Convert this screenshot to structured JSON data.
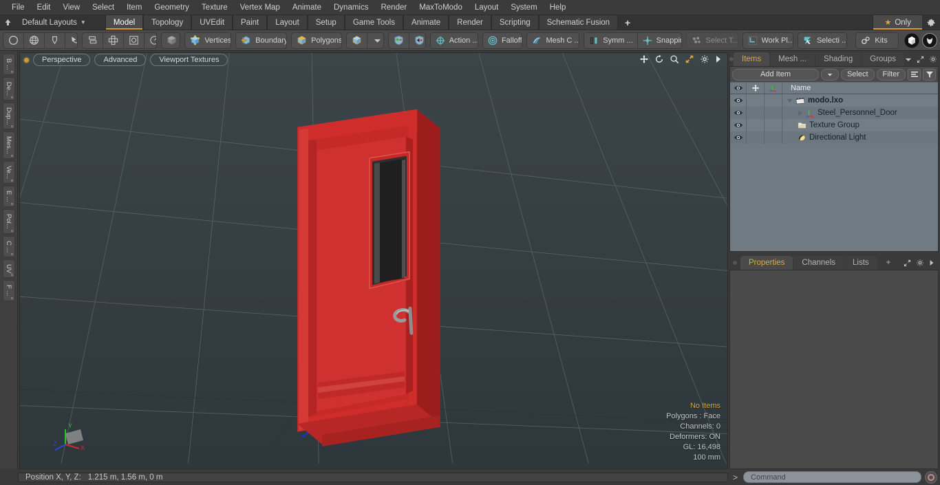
{
  "app": {
    "title": "modo"
  },
  "menubar": {
    "items": [
      {
        "label": "File"
      },
      {
        "label": "Edit"
      },
      {
        "label": "View"
      },
      {
        "label": "Select"
      },
      {
        "label": "Item"
      },
      {
        "label": "Geometry"
      },
      {
        "label": "Texture"
      },
      {
        "label": "Vertex Map"
      },
      {
        "label": "Animate"
      },
      {
        "label": "Dynamics"
      },
      {
        "label": "Render"
      },
      {
        "label": "MaxToModo"
      },
      {
        "label": "Layout"
      },
      {
        "label": "System"
      },
      {
        "label": "Help"
      }
    ]
  },
  "layoutbar": {
    "home_icon": "home-icon",
    "layout_name": "Default Layouts",
    "tabs": [
      {
        "label": "Model",
        "active": true
      },
      {
        "label": "Topology",
        "active": false
      },
      {
        "label": "UVEdit",
        "active": false
      },
      {
        "label": "Paint",
        "active": false
      },
      {
        "label": "Layout",
        "active": false
      },
      {
        "label": "Setup",
        "active": false
      },
      {
        "label": "Game Tools",
        "active": false
      },
      {
        "label": "Animate",
        "active": false
      },
      {
        "label": "Render",
        "active": false
      },
      {
        "label": "Scripting",
        "active": false
      },
      {
        "label": "Schematic Fusion",
        "active": false
      }
    ],
    "add_tab_label": "+",
    "only_label": "Only",
    "settings_icon": "gear-icon"
  },
  "toolbar": {
    "groups": [
      {
        "name": "primitives",
        "buttons": [
          {
            "label": "",
            "icon": "circle-icon"
          },
          {
            "label": "",
            "icon": "globe-icon"
          },
          {
            "label": "",
            "icon": "pen-icon"
          },
          {
            "label": "",
            "icon": "curve-icon"
          }
        ]
      },
      {
        "name": "align",
        "buttons": [
          {
            "label": "",
            "icon": "align-icon"
          },
          {
            "label": "",
            "icon": "center-icon"
          },
          {
            "label": "",
            "icon": "bound-icon"
          },
          {
            "label": "",
            "icon": "radial-icon"
          }
        ]
      },
      {
        "name": "selmode",
        "buttons": [
          {
            "label": "",
            "icon": "cube-gray-icon"
          }
        ]
      },
      {
        "name": "components",
        "buttons": [
          {
            "label": "Vertices",
            "icon": "cube-blue-icon"
          }
        ]
      },
      {
        "name": "boundary",
        "buttons": [
          {
            "label": "Boundary",
            "icon": "cube-arrow-icon"
          }
        ]
      },
      {
        "name": "polygons",
        "buttons": [
          {
            "label": "Polygons",
            "icon": "cube-orange-icon"
          }
        ]
      },
      {
        "name": "itemmode",
        "buttons": [
          {
            "label": "",
            "icon": "cube-item-icon"
          },
          {
            "label": "",
            "icon": "chevron-down-icon"
          }
        ]
      },
      {
        "name": "shield",
        "buttons": [
          {
            "label": "",
            "icon": "shield-a-icon"
          },
          {
            "label": "",
            "icon": "shield-b-icon"
          }
        ]
      },
      {
        "name": "action",
        "buttons": [
          {
            "label": "Action  ...",
            "icon": "action-center-icon"
          }
        ]
      },
      {
        "name": "falloff",
        "buttons": [
          {
            "label": "Falloff",
            "icon": "falloff-icon"
          }
        ]
      },
      {
        "name": "meshconstraint",
        "buttons": [
          {
            "label": "Mesh C ...",
            "icon": "mesh-constraint-icon"
          }
        ]
      },
      {
        "name": "symmetry",
        "buttons": [
          {
            "label": "Symm ...",
            "icon": "symmetry-icon"
          },
          {
            "label": "Snapping",
            "icon": "snapping-icon"
          }
        ]
      },
      {
        "name": "selthrough",
        "buttons": [
          {
            "label": "Select T...",
            "icon": "select-through-icon",
            "dim": true
          }
        ]
      },
      {
        "name": "workplane",
        "buttons": [
          {
            "label": "Work Pl...",
            "icon": "work-plane-icon"
          }
        ]
      },
      {
        "name": "selectset",
        "buttons": [
          {
            "label": "Selecti ...",
            "icon": "selection-icon"
          }
        ]
      },
      {
        "name": "kits",
        "buttons": [
          {
            "label": "Kits",
            "icon": "kits-gear-icon"
          }
        ]
      },
      {
        "name": "logos",
        "buttons": [
          {
            "label": "",
            "icon": "modo-logo-icon"
          },
          {
            "label": "",
            "icon": "unreal-logo-icon"
          }
        ]
      }
    ]
  },
  "left_strip": {
    "tabs": [
      {
        "label": "B ..."
      },
      {
        "label": "De..."
      },
      {
        "label": "Dup..."
      },
      {
        "label": "Mes..."
      },
      {
        "label": "Ve..."
      },
      {
        "label": "E ..."
      },
      {
        "label": "Pol..."
      },
      {
        "label": "C ..."
      },
      {
        "label": "UV"
      },
      {
        "label": "F ..."
      }
    ]
  },
  "viewport": {
    "buttons": [
      {
        "label": "Perspective"
      },
      {
        "label": "Advanced"
      },
      {
        "label": "Viewport Textures"
      }
    ],
    "icons": [
      {
        "name": "move-icon"
      },
      {
        "name": "rotate-icon"
      },
      {
        "name": "zoom-icon"
      },
      {
        "name": "fit-icon"
      },
      {
        "name": "gear-icon"
      },
      {
        "name": "play-arrow-icon"
      }
    ],
    "stats": {
      "selection": "No Items",
      "polygons": "Polygons : Face",
      "channels": "Channels: 0",
      "deformers": "Deformers: ON",
      "gl": "GL: 16,498",
      "grid": "100 mm"
    },
    "axis": {
      "x": "X",
      "y": "Y",
      "z": "Z"
    },
    "colors": {
      "bg_top": "#3b4448",
      "bg_bottom": "#2f383c",
      "grid": "#5d686d",
      "model_red": "#cc2b2b",
      "axis_x": "#d11f2a",
      "axis_y": "#2bbd2b",
      "axis_z": "#2b44d1"
    }
  },
  "right_panel": {
    "top_tabs": [
      {
        "label": "Items",
        "active": true
      },
      {
        "label": "Mesh ...",
        "active": false
      },
      {
        "label": "Shading",
        "active": false
      },
      {
        "label": "Groups",
        "active": false
      }
    ],
    "top_tab_icons": [
      "chevron-down-icon",
      "expand-icon",
      "gear-icon",
      "play-arrow-icon"
    ],
    "items_toolbar": {
      "add_item_label": "Add Item",
      "add_item_dropdown_icon": "chevron-down-icon",
      "select_label": "Select",
      "filter_label": "Filter",
      "list_icon": "list-icon",
      "funnel_icon": "funnel-icon"
    },
    "tree_headers": {
      "eye": "eye-icon",
      "move": "move-icon",
      "axis": "axis-icon",
      "name": "Name"
    },
    "tree_rows": [
      {
        "label": "modo.lxo",
        "icon": "scene-icon",
        "indent": 0,
        "bold": true,
        "expander": "down",
        "eye": true
      },
      {
        "label": "Steel_Personnel_Door",
        "icon": "mesh-axis-icon",
        "indent": 1,
        "bold": false,
        "expander": "right",
        "eye": true
      },
      {
        "label": "Texture Group",
        "icon": "texture-group-icon",
        "indent": 1,
        "bold": false,
        "expander": "none",
        "eye": true
      },
      {
        "label": "Directional Light",
        "icon": "light-icon",
        "indent": 1,
        "bold": false,
        "expander": "none",
        "eye": true
      }
    ],
    "bottom_tabs": [
      {
        "label": "Properties",
        "active": true
      },
      {
        "label": "Channels",
        "active": false
      },
      {
        "label": "Lists",
        "active": false
      },
      {
        "label": "+",
        "active": false
      }
    ],
    "bottom_tab_icons": [
      "expand-icon",
      "gear-icon",
      "play-arrow-icon"
    ]
  },
  "statusbar": {
    "position_label": "Position X, Y, Z:",
    "position_value": "1.215 m, 1.56 m, 0 m",
    "command_prompt": ">",
    "command_placeholder": "Command",
    "record_icon": "record-icon"
  }
}
